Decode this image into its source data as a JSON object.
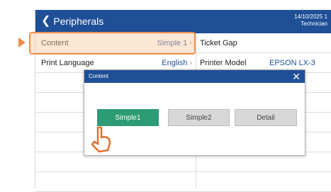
{
  "header": {
    "back_label": "Peripherals",
    "date": "14/10/2025 1",
    "user": "Technician"
  },
  "rows": [
    {
      "label": "Content",
      "value": "Simple 1",
      "label2": "Ticket Gap",
      "value2": ""
    },
    {
      "label": "Print Language",
      "value": "English",
      "label2": "Printer Model",
      "value2": "EPSON LX-3"
    }
  ],
  "modal": {
    "title": "Content",
    "options": [
      "Simple1",
      "Simple2",
      "Detail"
    ],
    "selected": "Simple1"
  },
  "colors": {
    "header": "#1f4f96",
    "selected_option": "#2d9b73",
    "highlight": "#f0914b"
  }
}
